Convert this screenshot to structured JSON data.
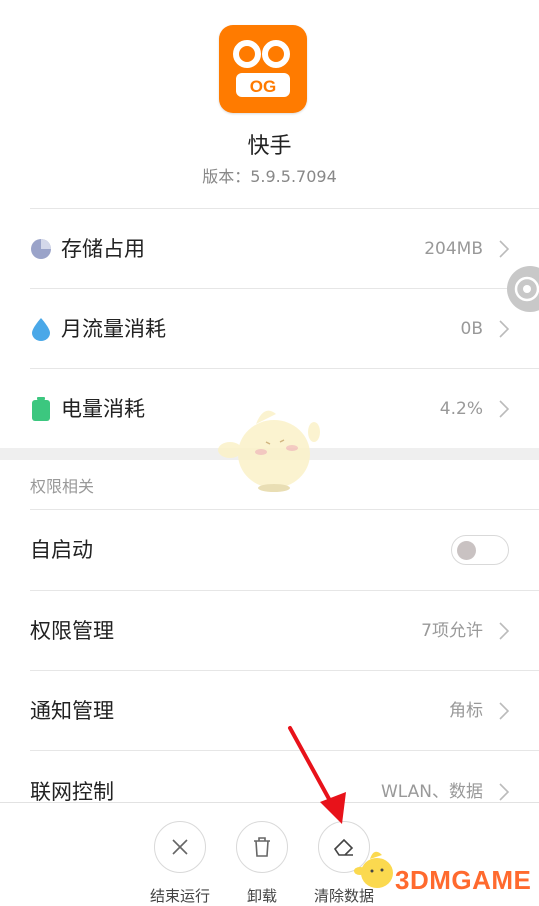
{
  "app": {
    "name": "快手",
    "version": "版本：5.9.5.7094"
  },
  "usage": [
    {
      "label": "存储占用",
      "value": "204MB",
      "icon": "pie-chart-icon",
      "color": "#9aa3c9"
    },
    {
      "label": "月流量消耗",
      "value": "0B",
      "icon": "water-drop-icon",
      "color": "#4aa8e8"
    },
    {
      "label": "电量消耗",
      "value": "4.2%",
      "icon": "battery-icon",
      "color": "#3cc77f"
    }
  ],
  "permissions": {
    "section_title": "权限相关",
    "autostart": {
      "label": "自启动",
      "enabled": false
    },
    "manage": {
      "label": "权限管理",
      "value": "7项允许"
    },
    "notify": {
      "label": "通知管理",
      "value": "角标"
    },
    "network": {
      "label": "联网控制",
      "value": "WLAN、数据"
    }
  },
  "actions": [
    {
      "label": "结束运行",
      "icon": "close-icon"
    },
    {
      "label": "卸载",
      "icon": "trash-icon"
    },
    {
      "label": "清除数据",
      "icon": "eraser-icon"
    }
  ],
  "watermark": {
    "text": "3DMGAME"
  },
  "colors": {
    "brand": "#ff7b00",
    "arrow": "#e8121a",
    "watermark": "#ff6a2e"
  }
}
